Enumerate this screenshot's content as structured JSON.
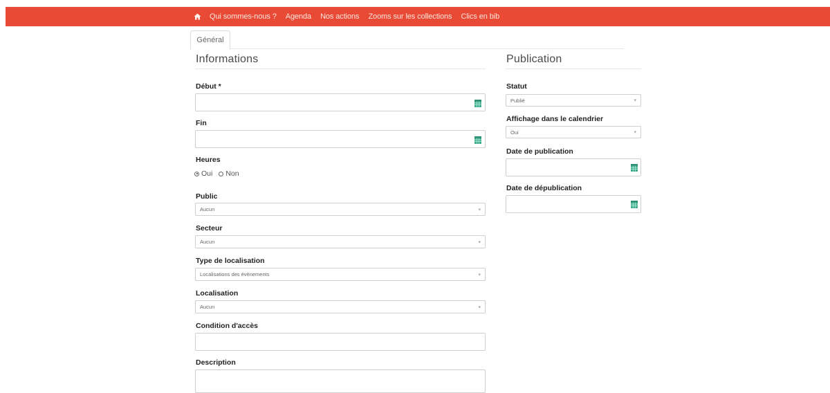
{
  "nav": {
    "home_icon": "home-icon",
    "items": [
      "Qui sommes-nous ?",
      "Agenda",
      "Nos actions",
      "Zooms sur les collections",
      "Clics en bib"
    ]
  },
  "tabs": {
    "general": "Général"
  },
  "informations": {
    "title": "Informations",
    "debut_label": "Début *",
    "fin_label": "Fin",
    "heures_label": "Heures",
    "heures_options": [
      "Oui",
      "Non"
    ],
    "heures_selected": "Oui",
    "public_label": "Public",
    "public_value": "Aucun",
    "secteur_label": "Secteur",
    "secteur_value": "Aucun",
    "type_localisation_label": "Type de localisation",
    "type_localisation_value": "Localisations des évènements",
    "localisation_label": "Localisation",
    "localisation_value": "Aucun",
    "condition_label": "Condition d'accès",
    "description_label": "Description"
  },
  "publication": {
    "title": "Publication",
    "statut_label": "Statut",
    "statut_value": "Publié",
    "affichage_label": "Affichage dans le calendrier",
    "affichage_value": "Oui",
    "date_publication_label": "Date de publication",
    "date_depublication_label": "Date de dépublication"
  },
  "colors": {
    "nav_background": "#e84a35",
    "calendar_icon": "#3aaa8a"
  }
}
